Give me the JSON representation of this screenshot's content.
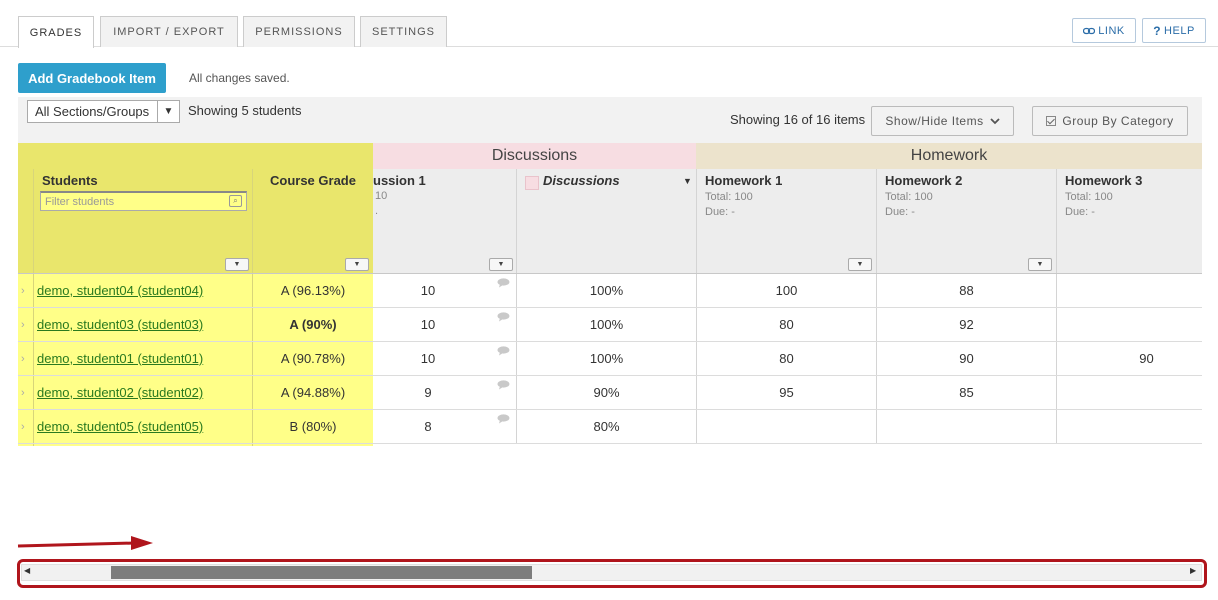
{
  "tabs": [
    {
      "label": "GRADES"
    },
    {
      "label": "IMPORT / EXPORT"
    },
    {
      "label": "PERMISSIONS"
    },
    {
      "label": "SETTINGS"
    }
  ],
  "top_buttons": {
    "link": "LINK",
    "help": "HELP"
  },
  "toolbar": {
    "add_label": "Add Gradebook Item",
    "save_status": "All changes saved.",
    "section_select": "All Sections/Groups",
    "showing_students": "Showing 5 students",
    "showing_items": "Showing 16 of 16 items",
    "show_hide": "Show/Hide Items",
    "group_by": "Group By Category"
  },
  "categories": {
    "discussions": "Discussions",
    "homework": "Homework"
  },
  "columns": {
    "students": "Students",
    "filter_placeholder": "Filter students",
    "course_grade": "Course Grade",
    "disc1_title": "ussion 1",
    "disc1_sub": "10",
    "disc1_sub2": ".",
    "disc_cat_title": "Discussions",
    "hw1": {
      "title": "Homework 1",
      "total": "Total: 100",
      "due": "Due: -"
    },
    "hw2": {
      "title": "Homework 2",
      "total": "Total: 100",
      "due": "Due: -"
    },
    "hw3": {
      "title": "Homework 3",
      "total": "Total: 100",
      "due": "Due: -"
    }
  },
  "rows": [
    {
      "student": "demo, student04 (student04)",
      "grade": "A (96.13%)",
      "disc1": "10",
      "disc_cat": "100%",
      "hw1": "100",
      "hw2": "88",
      "hw3": ""
    },
    {
      "student": "demo, student03 (student03)",
      "grade": "A (90%)",
      "disc1": "10",
      "disc_cat": "100%",
      "hw1": "80",
      "hw2": "92",
      "hw3": ""
    },
    {
      "student": "demo, student01 (student01)",
      "grade": "A (90.78%)",
      "disc1": "10",
      "disc_cat": "100%",
      "hw1": "80",
      "hw2": "90",
      "hw3": "90"
    },
    {
      "student": "demo, student02 (student02)",
      "grade": "A (94.88%)",
      "disc1": "9",
      "disc_cat": "90%",
      "hw1": "95",
      "hw2": "85",
      "hw3": ""
    },
    {
      "student": "demo, student05 (student05)",
      "grade": "B (80%)",
      "disc1": "8",
      "disc_cat": "80%",
      "hw1": "",
      "hw2": "",
      "hw3": ""
    }
  ],
  "colors": {
    "accent": "#2e9fcc",
    "fixed_bg": "#ffff88",
    "fixed_header": "#e9e66c",
    "discussions_cat": "#f7dde2",
    "homework_cat": "#ece3cc",
    "annotation_red": "#b0151c",
    "link_green": "#2a7a1f"
  },
  "icons": {
    "link": "chain-link-icon",
    "help": "question-mark-icon",
    "comment": "speech-bubble-icon"
  }
}
